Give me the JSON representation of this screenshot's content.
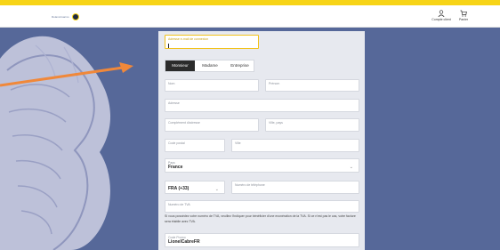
{
  "header": {
    "logo_text": "Roland-Garros",
    "account_label": "Compte client",
    "cart_label": "Panier"
  },
  "form": {
    "email_label": "Adresse e-mail de connexion",
    "tabs": [
      {
        "label": "Monsieur"
      },
      {
        "label": "Madame"
      },
      {
        "label": "Entreprise"
      }
    ],
    "name_label": "Nom",
    "firstname_label": "Prénom",
    "address_label": "Adresse",
    "address2_label": "Complément d'adresse",
    "extra_label": "Ville, pays",
    "zip_label": "Code postal",
    "city_label": "Ville",
    "country_label": "Pays",
    "country_value": "France",
    "phone_prefix_value": "FRA (+33)",
    "phone_label": "Numéro de téléphone",
    "tva_label": "Numéro de TVA",
    "note_text": "Si vous possédez votre numéro de TVA, veuillez l'indiquer pour bénéficier d'une exonération de la TVA. Si ce n'est pas le cas, votre facture sera établie avec TVA.",
    "promo_label": "Code Promo",
    "promo_value": "LionelCabreFR"
  },
  "colors": {
    "accent": "#f7d417",
    "background": "#566899",
    "tab_active": "#2b2b2b"
  }
}
